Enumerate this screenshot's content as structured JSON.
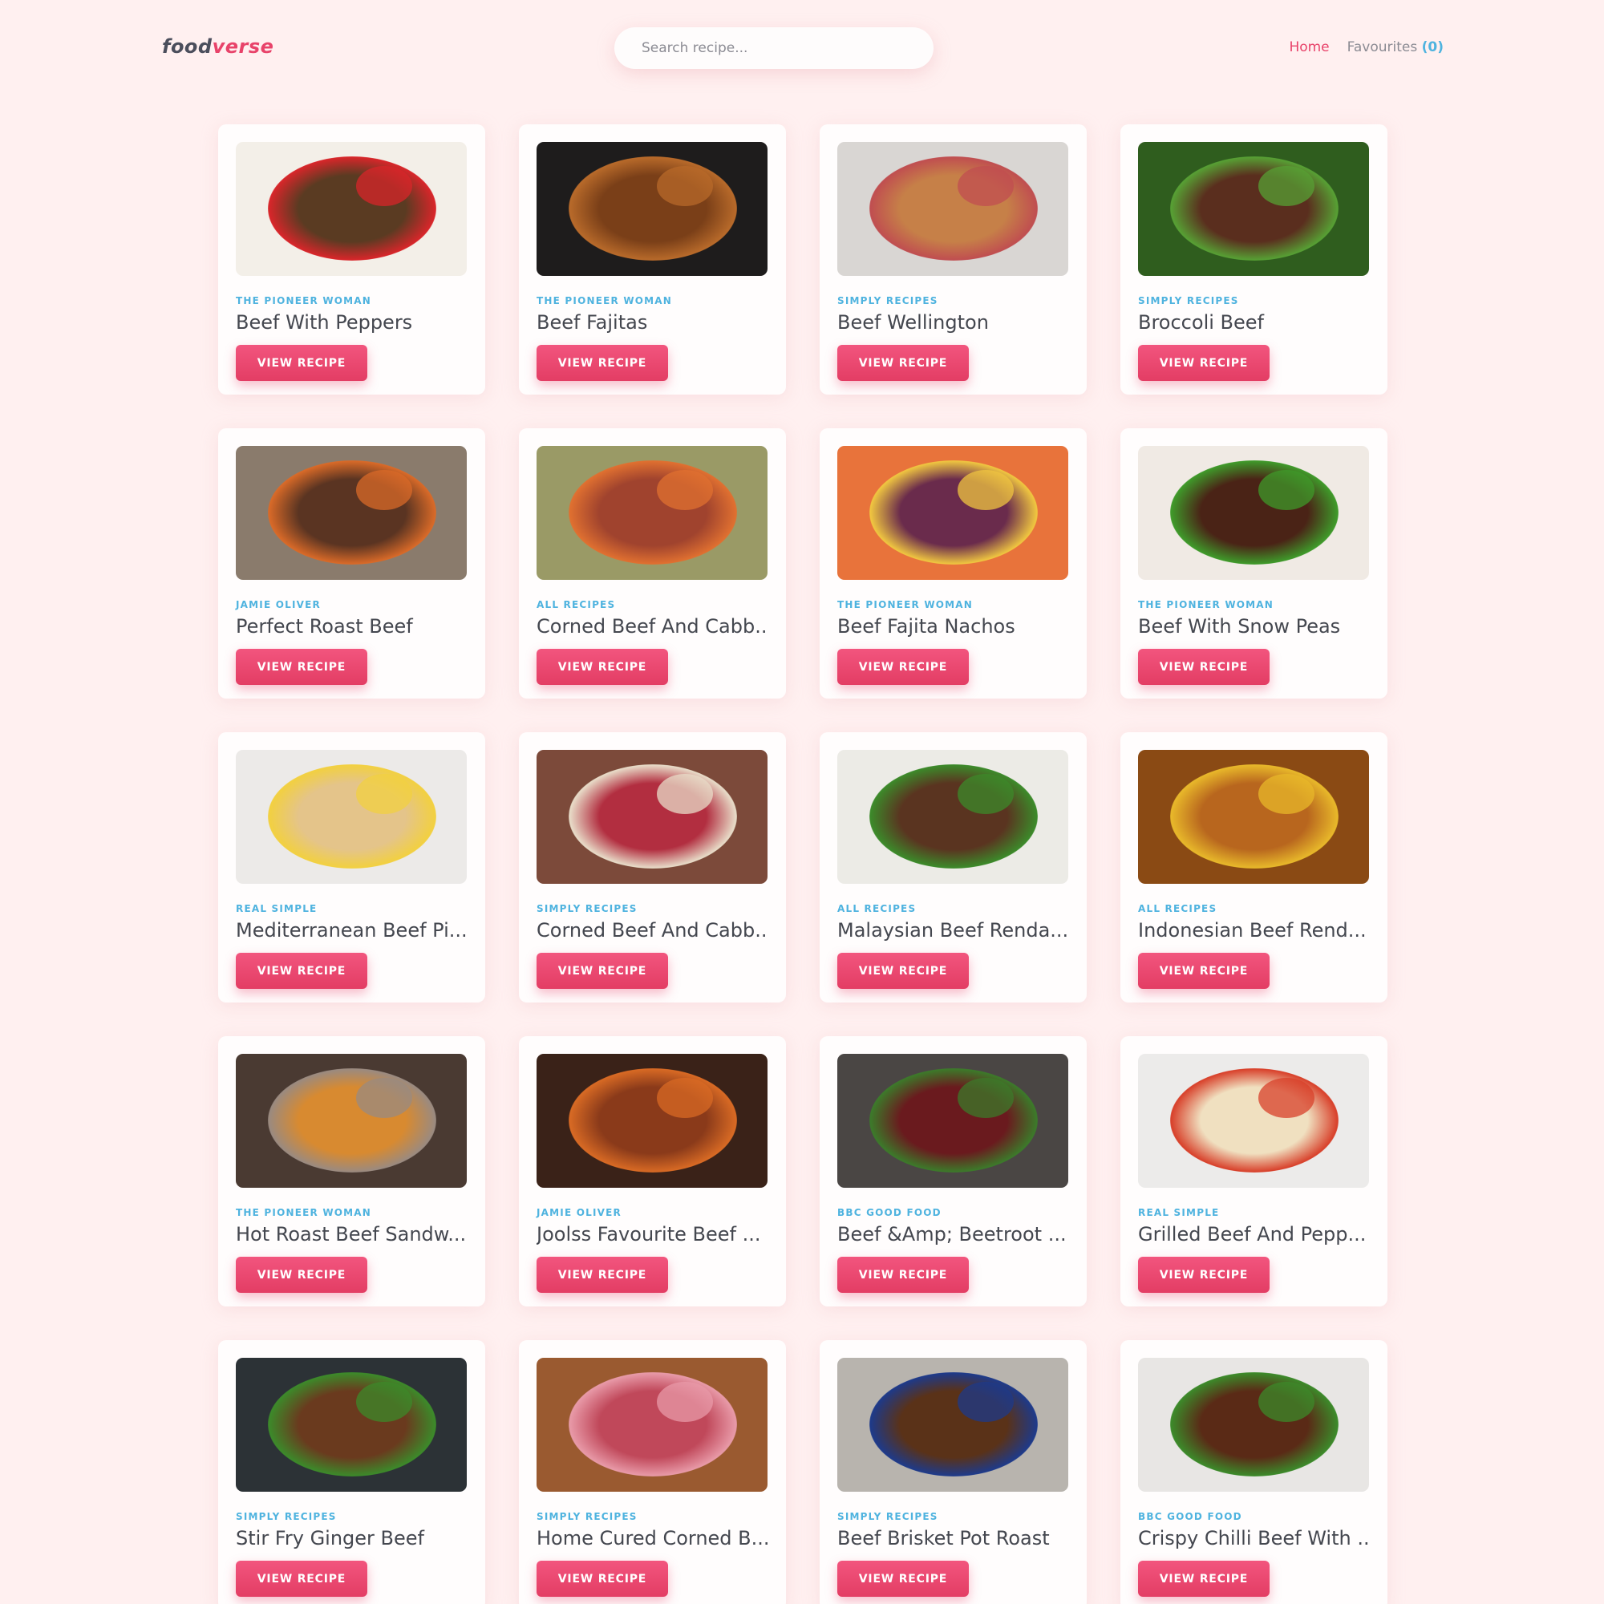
{
  "app": {
    "logo_part1": "food",
    "logo_part2": "verse"
  },
  "search": {
    "placeholder": "Search recipe..."
  },
  "nav": {
    "home": "Home",
    "favourites": "Favourites",
    "favourites_count": "(0)"
  },
  "button_label": "VIEW RECIPE",
  "recipes": [
    {
      "publisher": "THE PIONEER WOMAN",
      "title": "Beef With Peppers",
      "bg": "#f3efe8",
      "food": "#5a3b22",
      "accent": "#d8262a"
    },
    {
      "publisher": "THE PIONEER WOMAN",
      "title": "Beef Fajitas",
      "bg": "#1e1c1c",
      "food": "#7a3f18",
      "accent": "#b86a2a"
    },
    {
      "publisher": "SIMPLY RECIPES",
      "title": "Beef Wellington",
      "bg": "#d9d6d3",
      "food": "#c68048",
      "accent": "#c04e50"
    },
    {
      "publisher": "SIMPLY RECIPES",
      "title": "Broccoli Beef",
      "bg": "#2f5d1e",
      "food": "#5a2e1e",
      "accent": "#57a034"
    },
    {
      "publisher": "JAMIE OLIVER",
      "title": "Perfect Roast Beef",
      "bg": "#8a7b6c",
      "food": "#5a3422",
      "accent": "#d96a28"
    },
    {
      "publisher": "ALL RECIPES",
      "title": "Corned Beef And Cabb...",
      "bg": "#9a9a66",
      "food": "#a0432e",
      "accent": "#e07030"
    },
    {
      "publisher": "THE PIONEER WOMAN",
      "title": "Beef Fajita Nachos",
      "bg": "#e8733b",
      "food": "#6a2b4c",
      "accent": "#f0c640"
    },
    {
      "publisher": "THE PIONEER WOMAN",
      "title": "Beef With Snow Peas",
      "bg": "#f0eae4",
      "food": "#4a2316",
      "accent": "#3f9a2a"
    },
    {
      "publisher": "REAL SIMPLE",
      "title": "Mediterranean Beef Pi...",
      "bg": "#eceae8",
      "food": "#e4c48a",
      "accent": "#f2d040"
    },
    {
      "publisher": "SIMPLY RECIPES",
      "title": "Corned Beef And Cabb...",
      "bg": "#7c4a3a",
      "food": "#b22e40",
      "accent": "#e8dcc8"
    },
    {
      "publisher": "ALL RECIPES",
      "title": "Malaysian Beef Renda...",
      "bg": "#ecebe6",
      "food": "#5a3420",
      "accent": "#3c8a2a"
    },
    {
      "publisher": "ALL RECIPES",
      "title": "Indonesian Beef Rend...",
      "bg": "#8a4a14",
      "food": "#b8661e",
      "accent": "#e8b82a"
    },
    {
      "publisher": "THE PIONEER WOMAN",
      "title": "Hot Roast Beef Sandw...",
      "bg": "#4a3a32",
      "food": "#d88a30",
      "accent": "#9a8a80"
    },
    {
      "publisher": "JAMIE OLIVER",
      "title": "Joolss Favourite Beef ...",
      "bg": "#3a2218",
      "food": "#8a3a1a",
      "accent": "#d86a24"
    },
    {
      "publisher": "BBC GOOD FOOD",
      "title": "Beef &Amp; Beetroot ...",
      "bg": "#4a4644",
      "food": "#6a1a1e",
      "accent": "#3c7a2a"
    },
    {
      "publisher": "REAL SIMPLE",
      "title": "Grilled Beef And Pepp...",
      "bg": "#ecebea",
      "food": "#f0e0c0",
      "accent": "#d8402a"
    },
    {
      "publisher": "SIMPLY RECIPES",
      "title": "Stir Fry Ginger Beef",
      "bg": "#2c3236",
      "food": "#6a3a1e",
      "accent": "#3c8a2a"
    },
    {
      "publisher": "SIMPLY RECIPES",
      "title": "Home Cured Corned B...",
      "bg": "#9a5a30",
      "food": "#c0485a",
      "accent": "#e89aa8"
    },
    {
      "publisher": "SIMPLY RECIPES",
      "title": "Beef Brisket Pot Roast",
      "bg": "#b8b4ae",
      "food": "#5a3218",
      "accent": "#1e3a8a"
    },
    {
      "publisher": "BBC GOOD FOOD",
      "title": "Crispy Chilli Beef With ...",
      "bg": "#e8e6e4",
      "food": "#5a2a16",
      "accent": "#3c8a2a"
    }
  ]
}
